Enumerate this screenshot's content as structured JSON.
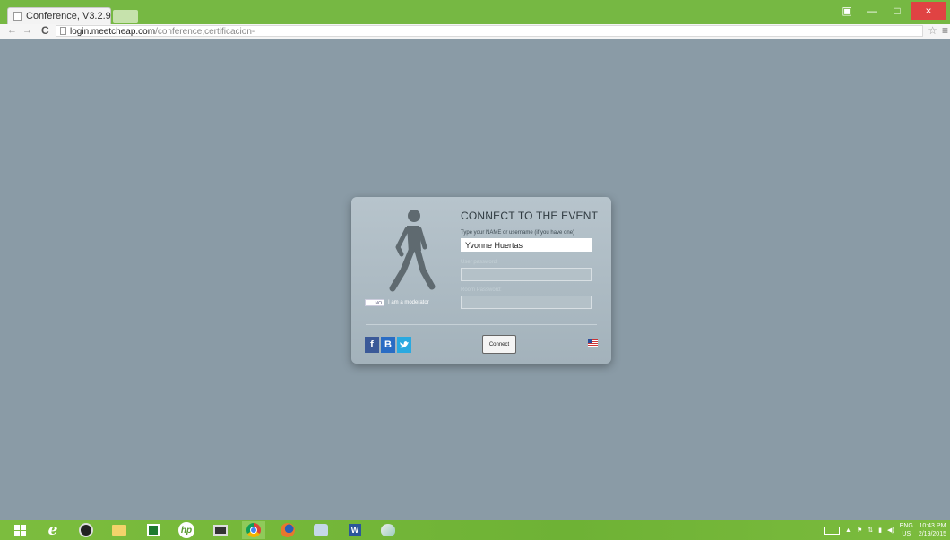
{
  "browser": {
    "tab_title": "Conference, V3.2.9 -- ×",
    "tab_close": "×",
    "url_host": "login.meetcheap.com",
    "url_path": "/conference,certificacion-",
    "back": "←",
    "forward": "→",
    "reload": "C",
    "star": "☆",
    "menu": "≡",
    "window_controls": {
      "restore_badge": "▣",
      "minimize": "—",
      "maximize": "□",
      "close": "×"
    }
  },
  "dialog": {
    "title": "CONNECT TO THE EVENT",
    "name_label": "Type your NAME or username (if you have one)",
    "name_value": "Yvonne Huertas",
    "password_label": "User password:",
    "room_password_label": "Room Password:",
    "moderator_toggle": "NO",
    "moderator_label": "I am a moderator",
    "connect_button": "Connect",
    "social": [
      "f",
      "B",
      "t"
    ]
  },
  "taskbar": {
    "apps": [
      "windows-start",
      "internet-explorer",
      "media-player",
      "file-explorer",
      "store",
      "hp",
      "app-manager",
      "chrome",
      "firefox",
      "paint-tool",
      "word",
      "paint"
    ],
    "app_glyphs": {
      "internet-explorer": "e",
      "hp": "hp",
      "word": "W"
    },
    "lang": "ENG",
    "region": "US",
    "time": "10:43 PM",
    "date": "2/19/2015"
  },
  "colors": {
    "page_bg": "#8a9ba6",
    "chrome_green": "#76b843",
    "facebook": "#3b5998",
    "twitter": "#2aa9e0",
    "close_red": "#e04343"
  }
}
